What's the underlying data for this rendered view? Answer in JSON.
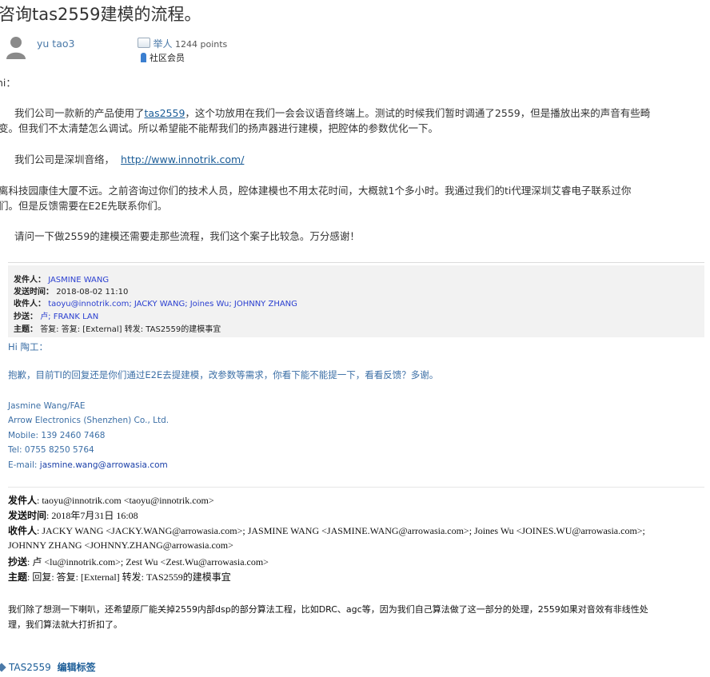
{
  "post": {
    "title": "咨询tas2559建模的流程。",
    "author": "yu tao3",
    "role": "举人",
    "points": "1244 points",
    "member": "社区会员"
  },
  "body": {
    "greeting": "hi：",
    "p1a": "我们公司一款新的产品使用了",
    "p1_link": "tas2559",
    "p1b": "，这个功放用在我们一会会议语音终端上。测试的时候我们暂时调通了2559，但是播放出来的声音有些畸",
    "p1c": "变。但我们不太清楚怎么调试。所以希望能不能帮我们的扬声器进行建模，把腔体的参数优化一下。",
    "p2a": "我们公司是深圳音络，",
    "p2_link": "http://www.innotrik.com/",
    "p3a": "离科技园康佳大厦不远。之前咨询过你们的技术人员，腔体建模也不用太花时间，大概就1个多小时。我通过我们的ti代理深圳艾睿电子联系过你",
    "p3b": "们。但是反馈需要在E2E先联系你们。",
    "p4": "请问一下做2559的建模还需要走那些流程，我们这个案子比较急。万分感谢！"
  },
  "email1": {
    "from_label": "发件人：",
    "from": "JASMINE WANG",
    "sent_label": "发送时间：",
    "sent": "2018-08-02 11:10",
    "to_label": "收件人：",
    "to": "taoyu@innotrik.com; JACKY WANG; Joines Wu; JOHNNY ZHANG",
    "cc_label": "抄送：",
    "cc": "卢; FRANK LAN",
    "subject_label": "主题：",
    "subject": "答复: 答复: [External] 转发: TAS2559的建模事宜",
    "greeting": "Hi 陶工：",
    "body": "抱歉，目前TI的回复还是你们通过E2E去提建模，改参数等需求，你看下能不能提一下，看看反馈？多谢。",
    "sig": [
      "Jasmine Wang/FAE",
      "Arrow Electronics (Shenzhen) Co., Ltd.",
      "Mobile: 139 2460 7468",
      "Tel: 0755 8250 5764"
    ],
    "email_label": "E-mail: ",
    "email": "jasmine.wang@arrowasia.com"
  },
  "email2": {
    "from_label": "发件人",
    "from": ": taoyu@innotrik.com <taoyu@innotrik.com>",
    "sent_label": "发送时间",
    "sent": ": 2018年7月31日 16:08",
    "to_label": "收件人",
    "to1": ": JACKY WANG <JACKY.WANG@arrowasia.com>; JASMINE WANG <JASMINE.WANG@arrowasia.com>; Joines Wu <JOINES.WU@arrowasia.com>;",
    "to2": "JOHNNY ZHANG <JOHNNY.ZHANG@arrowasia.com>",
    "cc_label": "抄送",
    "cc": ": 卢 <lu@innotrik.com>; Zest Wu <Zest.Wu@arrowasia.com>",
    "subject_label": "主题",
    "subject": ": 回复: 答复: [External] 转发: TAS2559的建模事宜",
    "body1": "我们除了想测一下喇叭，还希望原厂能关掉2559内部dsp的部分算法工程，比如DRC、agc等，因为我们自己算法做了这一部分的处理，2559如果对音效有非线性处",
    "body2": "理，我们算法就大打折扣了。"
  },
  "tags": {
    "tag": "TAS2559",
    "edit_label": "编辑标签"
  }
}
